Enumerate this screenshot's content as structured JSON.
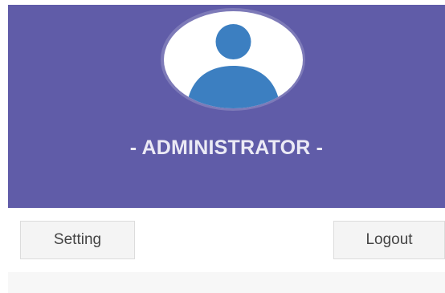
{
  "user_panel": {
    "role_label": "- ADMINISTRATOR -",
    "avatar_icon": "user-silhouette-icon",
    "header_color": "#605ca8",
    "avatar_color": "#3c7fc1"
  },
  "actions": {
    "setting_label": "Setting",
    "logout_label": "Logout"
  }
}
